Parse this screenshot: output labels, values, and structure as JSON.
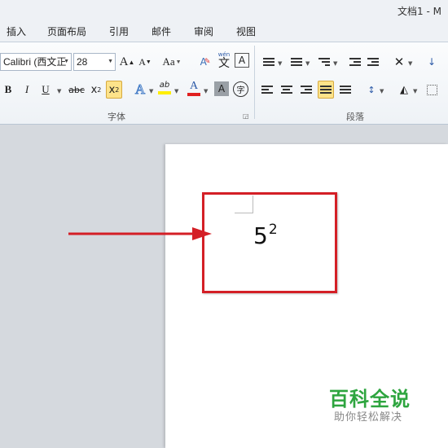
{
  "window": {
    "title": "文档1 - M"
  },
  "tabs": [
    "插入",
    "页面布局",
    "引用",
    "邮件",
    "审阅",
    "视图"
  ],
  "ribbon": {
    "font_group": {
      "label": "字体",
      "font_name": "Calibri (西文正",
      "font_size": "28",
      "aa_label": "Aa",
      "bold": "B",
      "italic": "I",
      "underline": "U",
      "strikethrough": "abc",
      "subscript": "x",
      "subscript_mark": "2",
      "superscript": "x",
      "superscript_mark": "2",
      "grow_font": "A",
      "shrink_font": "A",
      "text_effect": "A",
      "highlight": "ab",
      "font_color": "A",
      "shading": "A",
      "phonetic": "wén",
      "phonetic_char": "文",
      "border_char": "A",
      "enclose_char": "字",
      "clear_format": "A"
    },
    "paragraph_group": {
      "label": "段落"
    }
  },
  "document": {
    "base": "5",
    "exponent": "2"
  },
  "watermark": {
    "title": "百科全说",
    "subtitle": "助你轻松解决"
  },
  "colors": {
    "highlight_box": "#d41f26",
    "watermark_green": "#2ea53f",
    "active_button": "#fde38a"
  }
}
